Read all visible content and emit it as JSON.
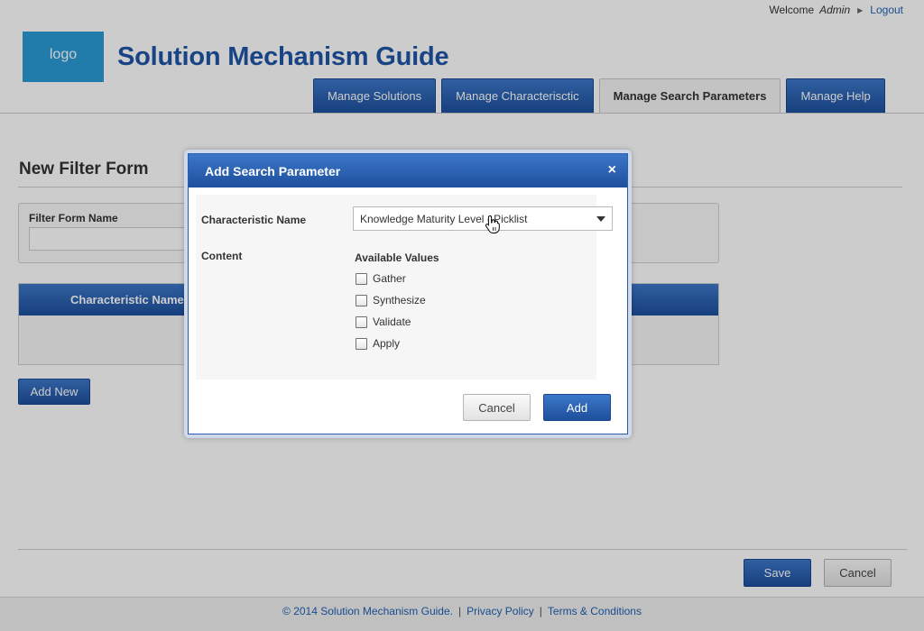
{
  "header": {
    "welcome": "Welcome",
    "user": "Admin",
    "logout": "Logout",
    "logo": "logo",
    "title": "Solution Mechanism Guide"
  },
  "tabs": [
    {
      "label": "Manage Solutions",
      "active": false
    },
    {
      "label": "Manage Characterisctic",
      "active": false
    },
    {
      "label": "Manage Search Parameters",
      "active": true
    },
    {
      "label": "Manage Help",
      "active": false
    }
  ],
  "main": {
    "page_title": "New Filter Form",
    "filter_form_name_label": "Filter Form Name",
    "filter_form_name_value": "",
    "grid_header": "Characteristic Name",
    "add_new": "Add New",
    "save": "Save",
    "cancel": "Cancel"
  },
  "footer": {
    "copyright": "© 2014 Solution Mechanism Guide.",
    "privacy": "Privacy Policy",
    "terms": "Terms & Conditions"
  },
  "dialog": {
    "title": "Add Search Parameter",
    "close": "×",
    "characteristic_label": "Characteristic Name",
    "characteristic_value": "Knowledge Maturity Level - Picklist",
    "content_label": "Content",
    "available_values_label": "Available Values",
    "values": [
      {
        "label": "Gather",
        "checked": false
      },
      {
        "label": "Synthesize",
        "checked": false
      },
      {
        "label": "Validate",
        "checked": false
      },
      {
        "label": "Apply",
        "checked": false
      }
    ],
    "cancel": "Cancel",
    "add": "Add"
  },
  "colors": {
    "brand_blue": "#1f56a8",
    "logo_bg": "#2a9ad6",
    "link": "#1f5fb3"
  }
}
